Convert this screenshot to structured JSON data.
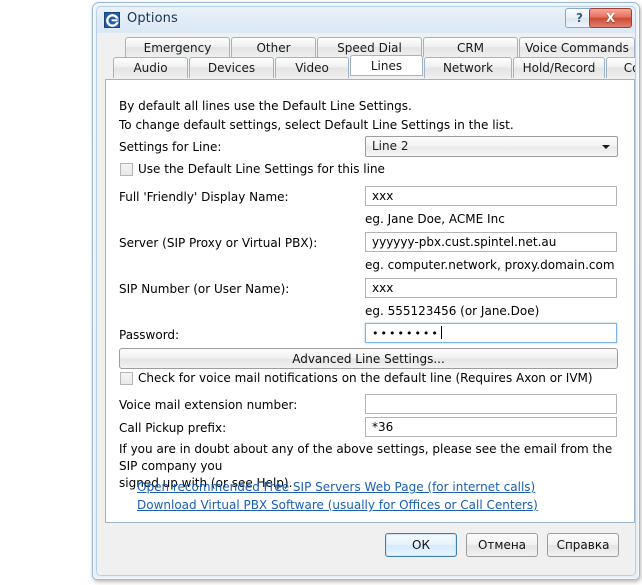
{
  "window": {
    "title": "Options",
    "icon": "app-logo-icon",
    "help_button_label": "?",
    "close_button_label": "X"
  },
  "tabs": {
    "row1": [
      {
        "label": "Emergency",
        "selected": false
      },
      {
        "label": "Other",
        "selected": false
      },
      {
        "label": "Speed Dial",
        "selected": false
      },
      {
        "label": "CRM",
        "selected": false
      },
      {
        "label": "Voice Commands",
        "selected": false
      }
    ],
    "row2": [
      {
        "label": "Audio",
        "selected": false
      },
      {
        "label": "Devices",
        "selected": false
      },
      {
        "label": "Video",
        "selected": false
      },
      {
        "label": "Lines",
        "selected": true
      },
      {
        "label": "Network",
        "selected": false
      },
      {
        "label": "Hold/Record",
        "selected": false
      },
      {
        "label": "Control",
        "selected": false
      }
    ]
  },
  "content": {
    "intro_line1": "By default all lines use the Default Line Settings.",
    "intro_line2": "To change default settings, select Default Line Settings in the list.",
    "settings_for_line_label": "Settings for Line:",
    "settings_for_line_value": "Line 2",
    "use_default_checkbox_label": "Use the Default Line Settings for this line",
    "use_default_checkbox_checked": false,
    "display_name_label": "Full 'Friendly' Display Name:",
    "display_name_value": "xxx",
    "display_name_hint": "eg. Jane Doe, ACME Inc",
    "server_label": "Server (SIP Proxy or Virtual PBX):",
    "server_value": "yyyyyy-pbx.cust.spintel.net.au",
    "server_hint": "eg. computer.network, proxy.domain.com",
    "sip_number_label": "SIP Number (or User Name):",
    "sip_number_value": "xxx",
    "sip_number_hint": "eg. 555123456 (or Jane.Doe)",
    "password_label": "Password:",
    "password_value": "••••••••",
    "advanced_button_label": "Advanced Line Settings...",
    "voicemail_checkbox_label": "Check for voice mail notifications on the default line (Requires Axon or IVM)",
    "voicemail_checkbox_checked": false,
    "voicemail_ext_label": "Voice mail extension number:",
    "voicemail_ext_value": "",
    "call_pickup_label": "Call Pickup prefix:",
    "call_pickup_value": "*36",
    "doubt_line1": "If you are in doubt about any of the above settings, please see the email from the SIP company you",
    "doubt_line2": "signed up with (or see Help).",
    "link_free_sip": "Open recommended Free SIP Servers Web Page (for internet calls)",
    "link_virtual_pbx": "Download Virtual PBX Software (usually for Offices or Call Centers)"
  },
  "footer": {
    "ok_label": "ОК",
    "cancel_label": "Отмена",
    "help_label": "Справка"
  },
  "colors": {
    "accent": "#1a5fb4",
    "title_text": "#16324f",
    "close_red": "#cf4a35"
  }
}
